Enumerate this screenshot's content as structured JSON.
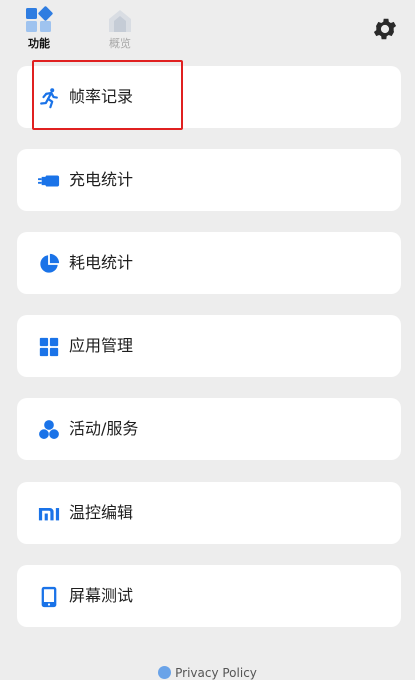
{
  "tabs": [
    {
      "label": "功能",
      "icon": "features-grid-icon",
      "active": true
    },
    {
      "label": "概览",
      "icon": "overview-house-icon",
      "active": false
    }
  ],
  "settings": {
    "icon": "gear-icon"
  },
  "menu": [
    {
      "label": "帧率记录",
      "icon": "running-person-icon"
    },
    {
      "label": "充电统计",
      "icon": "charger-plug-icon"
    },
    {
      "label": "耗电统计",
      "icon": "pie-chart-icon"
    },
    {
      "label": "应用管理",
      "icon": "app-grid-icon"
    },
    {
      "label": "活动/服务",
      "icon": "three-circles-icon"
    },
    {
      "label": "温控编辑",
      "icon": "mi-logo-icon"
    },
    {
      "label": "屏幕测试",
      "icon": "phone-screen-icon"
    }
  ],
  "footer": {
    "privacy_label": "Privacy Policy"
  },
  "colors": {
    "accent": "#1a73e8",
    "background": "#ededed",
    "card": "#ffffff",
    "highlight": "#e02020"
  }
}
